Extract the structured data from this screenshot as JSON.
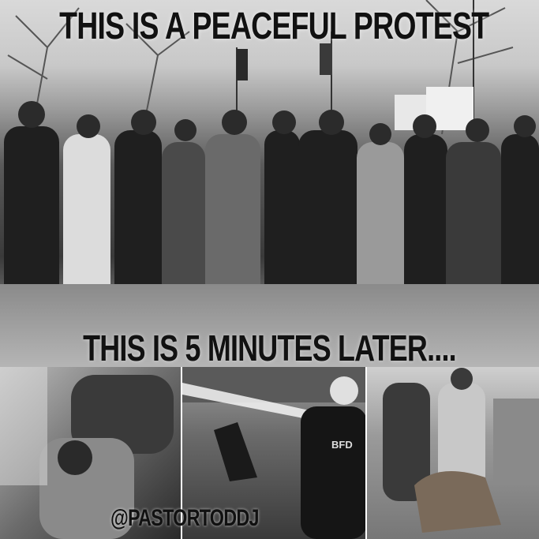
{
  "meme": {
    "top_caption": "THIS IS A PEACEFUL PROTEST",
    "middle_caption": "THIS IS 5 MINUTES LATER....",
    "handle": "@PASTORTODDJ",
    "helmet_text": "BFD"
  }
}
